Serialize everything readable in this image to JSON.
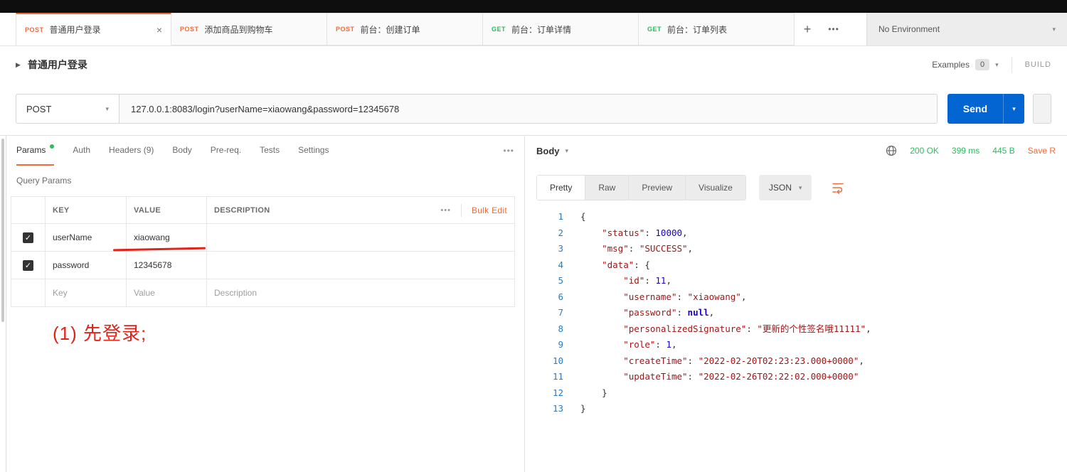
{
  "colors": {
    "accent_orange": "#f26b3a",
    "get_green": "#2cbb5d",
    "send_blue": "#0265d2",
    "status_green": "#2cbb5d",
    "annotation_red": "#e02419",
    "code_string": "#a31515",
    "code_number": "#1a01cc",
    "line_number": "#2b7ac1"
  },
  "tabbar": {
    "tabs": [
      {
        "method": "POST",
        "title": "普通用户登录",
        "active": true
      },
      {
        "method": "POST",
        "title": "添加商品到购物车",
        "active": false
      },
      {
        "method": "POST",
        "title": "前台：创建订单",
        "active": false
      },
      {
        "method": "GET",
        "title": "前台：订单详情",
        "active": false
      },
      {
        "method": "GET",
        "title": "前台：订单列表",
        "active": false
      }
    ],
    "add_label": "+",
    "more_label": "•••",
    "environment": "No Environment"
  },
  "request_header": {
    "title": "普通用户登录",
    "examples_label": "Examples",
    "examples_count": "0",
    "build_label": "BUILD"
  },
  "request_bar": {
    "method": "POST",
    "url": "127.0.0.1:8083/login?userName=xiaowang&password=12345678",
    "send_label": "Send"
  },
  "request_tabs": {
    "items": [
      {
        "label": "Params",
        "active": true,
        "dot": true
      },
      {
        "label": "Auth",
        "active": false
      },
      {
        "label": "Headers (9)",
        "active": false
      },
      {
        "label": "Body",
        "active": false
      },
      {
        "label": "Pre-req.",
        "active": false
      },
      {
        "label": "Tests",
        "active": false
      },
      {
        "label": "Settings",
        "active": false
      }
    ],
    "more_label": "•••"
  },
  "query_params": {
    "section_title": "Query Params",
    "columns": [
      "KEY",
      "VALUE",
      "DESCRIPTION"
    ],
    "more_label": "•••",
    "bulk_edit_label": "Bulk Edit",
    "rows": [
      {
        "key": "userName",
        "value": "xiaowang",
        "description": "",
        "checked": true
      },
      {
        "key": "password",
        "value": "12345678",
        "description": "",
        "checked": true
      }
    ],
    "placeholder_row": {
      "key": "Key",
      "value": "Value",
      "description": "Description"
    }
  },
  "annotation": {
    "text": "(1) 先登录;"
  },
  "response": {
    "tab_label": "Body",
    "status": "200 OK",
    "time": "399 ms",
    "size": "445 B",
    "save_label": "Save R",
    "view_tabs": [
      "Pretty",
      "Raw",
      "Preview",
      "Visualize"
    ],
    "active_view_tab": "Pretty",
    "format": "JSON",
    "code_lines": [
      [
        [
          "p",
          "{"
        ]
      ],
      [
        [
          "p",
          "    "
        ],
        [
          "k",
          "\"status\""
        ],
        [
          "p",
          ": "
        ],
        [
          "n",
          "10000"
        ],
        [
          "p",
          ","
        ]
      ],
      [
        [
          "p",
          "    "
        ],
        [
          "k",
          "\"msg\""
        ],
        [
          "p",
          ": "
        ],
        [
          "s",
          "\"SUCCESS\""
        ],
        [
          "p",
          ","
        ]
      ],
      [
        [
          "p",
          "    "
        ],
        [
          "k",
          "\"data\""
        ],
        [
          "p",
          ": {"
        ]
      ],
      [
        [
          "p",
          "        "
        ],
        [
          "k",
          "\"id\""
        ],
        [
          "p",
          ": "
        ],
        [
          "n",
          "11"
        ],
        [
          "p",
          ","
        ]
      ],
      [
        [
          "p",
          "        "
        ],
        [
          "k",
          "\"username\""
        ],
        [
          "p",
          ": "
        ],
        [
          "s",
          "\"xiaowang\""
        ],
        [
          "p",
          ","
        ]
      ],
      [
        [
          "p",
          "        "
        ],
        [
          "k",
          "\"password\""
        ],
        [
          "p",
          ": "
        ],
        [
          "u",
          "null"
        ],
        [
          "p",
          ","
        ]
      ],
      [
        [
          "p",
          "        "
        ],
        [
          "k",
          "\"personalizedSignature\""
        ],
        [
          "p",
          ": "
        ],
        [
          "s",
          "\"更新的个性签名哦11111\""
        ],
        [
          "p",
          ","
        ]
      ],
      [
        [
          "p",
          "        "
        ],
        [
          "k",
          "\"role\""
        ],
        [
          "p",
          ": "
        ],
        [
          "n",
          "1"
        ],
        [
          "p",
          ","
        ]
      ],
      [
        [
          "p",
          "        "
        ],
        [
          "k",
          "\"createTime\""
        ],
        [
          "p",
          ": "
        ],
        [
          "s",
          "\"2022-02-20T02:23:23.000+0000\""
        ],
        [
          "p",
          ","
        ]
      ],
      [
        [
          "p",
          "        "
        ],
        [
          "k",
          "\"updateTime\""
        ],
        [
          "p",
          ": "
        ],
        [
          "s",
          "\"2022-02-26T02:22:02.000+0000\""
        ]
      ],
      [
        [
          "p",
          "    }"
        ]
      ],
      [
        [
          "p",
          "}"
        ]
      ]
    ]
  }
}
